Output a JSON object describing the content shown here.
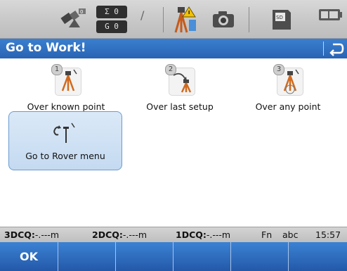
{
  "status": {
    "counts": [
      "Σ 0",
      "G 0"
    ],
    "tilt_symbol": "/"
  },
  "header": {
    "title": "Go to Work!",
    "back_icon": "undo-arrow-icon"
  },
  "tiles": [
    {
      "number": "1",
      "label": "Over known point",
      "icon": "tripod-known-point-icon"
    },
    {
      "number": "2",
      "label": "Over last setup",
      "icon": "tripod-last-setup-icon"
    },
    {
      "number": "3",
      "label": "Over any point",
      "icon": "tripod-any-point-icon"
    },
    {
      "label": "Go to Rover menu",
      "icon": "rover-pole-icon"
    }
  ],
  "quality": {
    "q3_label": "3DCQ:",
    "q3_value": "-.---m",
    "q2_label": "2DCQ:",
    "q2_value": "-.---m",
    "q1_label": "1DCQ:",
    "q1_value": "-.---m",
    "fn": "Fn",
    "input_mode": "abc",
    "time": "15:57"
  },
  "softkeys": [
    "OK",
    "",
    "",
    "",
    "",
    ""
  ],
  "colors": {
    "title_bar": "#2f6fc2",
    "softkey_bar": "#2d68ba",
    "selected_tile": "#cfe1f4"
  }
}
